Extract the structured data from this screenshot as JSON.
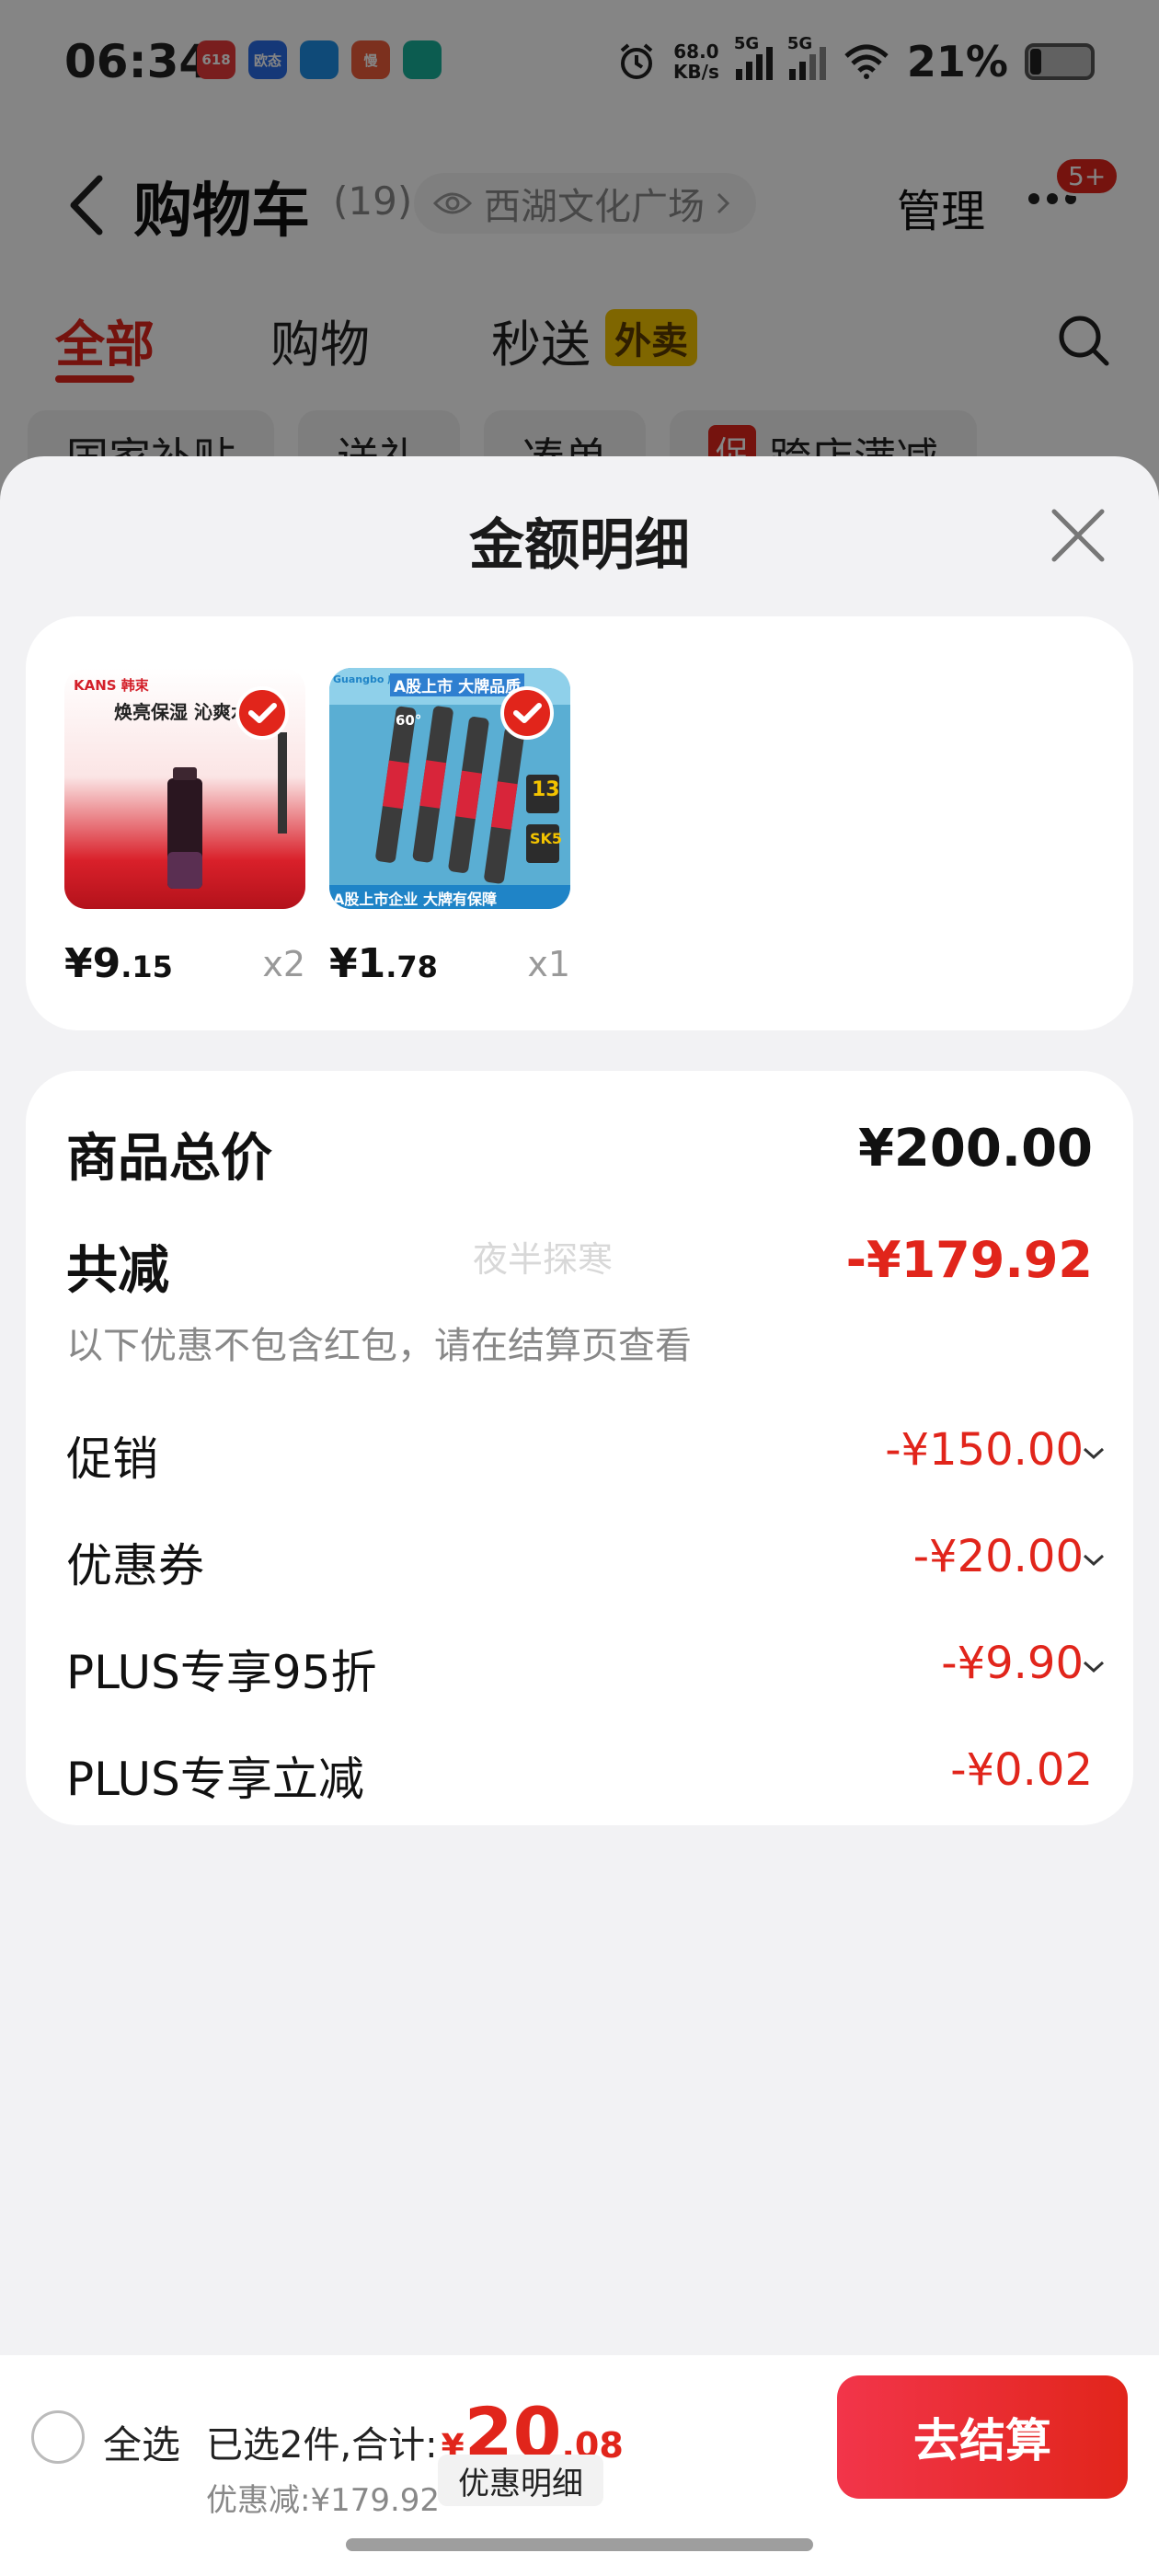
{
  "status_bar": {
    "time": "06:34",
    "net_speed_value": "68.0",
    "net_speed_unit": "KB/s",
    "signal1_label": "5G",
    "signal2_label": "5G",
    "battery": "21%",
    "app_icons": [
      {
        "name": "app-icon-1",
        "color": "#e83a3a",
        "text": "618"
      },
      {
        "name": "app-icon-2",
        "color": "#2a6be6",
        "text": "欧态"
      },
      {
        "name": "app-icon-3",
        "color": "#1e8fe6",
        "text": ""
      },
      {
        "name": "app-icon-4",
        "color": "#ee5c3a",
        "text": "慢"
      },
      {
        "name": "app-icon-5",
        "color": "#17b09a",
        "text": ""
      }
    ]
  },
  "nav": {
    "title": "购物车",
    "count": "(19)",
    "location": "西湖文化广场",
    "manage": "管理",
    "badge": "5+"
  },
  "tabs": [
    {
      "label": "全部",
      "active": true
    },
    {
      "label": "购物",
      "active": false
    },
    {
      "label": "秒送",
      "active": false,
      "tag": "外卖"
    }
  ],
  "chips": [
    {
      "label": "国家补贴"
    },
    {
      "label": "送礼"
    },
    {
      "label": "凑单"
    },
    {
      "label": "跨店满减",
      "tag": "促"
    }
  ],
  "sheet": {
    "title": "金额明细",
    "products": [
      {
        "price_int": "¥9",
        "price_dec": ".15",
        "qty": "x2",
        "brand": "KANS 韩束",
        "slogan": "焕亮保湿 沁爽水"
      },
      {
        "price_int": "¥1",
        "price_dec": ".78",
        "qty": "x1",
        "brand": "Guangbo 广博",
        "slogan": "A股上市 大牌品质",
        "badge_num": "13",
        "badge_sk": "SK5",
        "angle": "60°",
        "footer": "A股上市企业 大牌有保障"
      }
    ],
    "detail": {
      "total_label": "商品总价",
      "total_value": "¥200.00",
      "reduce_label": "共减",
      "reduce_value": "-¥179.92",
      "note": "以下优惠不包含红包，请在结算页查看",
      "watermark": "夜半探寒",
      "items": [
        {
          "label": "促销",
          "value": "-¥150.00",
          "expandable": true
        },
        {
          "label": "优惠券",
          "value": "-¥20.00",
          "expandable": true
        },
        {
          "label": "PLUS专享95折",
          "value": "-¥9.90",
          "expandable": true
        },
        {
          "label": "PLUS专享立减",
          "value": "-¥0.02",
          "expandable": false
        }
      ]
    }
  },
  "bottom_bar": {
    "select_all": "全选",
    "summary_prefix": "已选2件,合计:",
    "yen": "¥",
    "amount_int": "20",
    "amount_dec": ".08",
    "discount": "优惠减:¥179.92",
    "detail_button": "优惠明细",
    "checkout": "去结算"
  },
  "colors": {
    "accent_red": "#e1251b",
    "tag_yellow": "#f3c300"
  }
}
